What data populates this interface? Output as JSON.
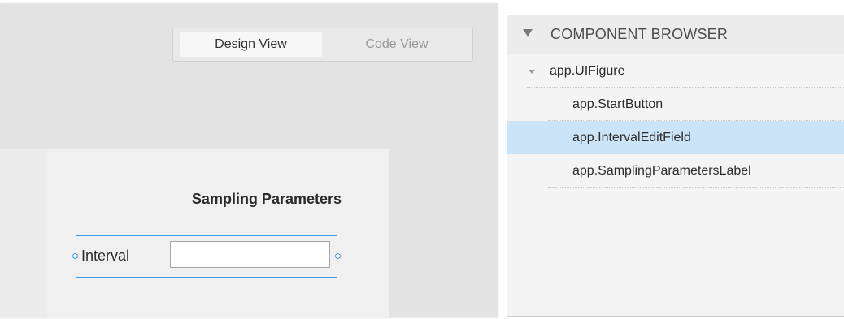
{
  "view_toggle": {
    "design_label": "Design View",
    "code_label": "Code View",
    "active": "Design View"
  },
  "app_figure": {
    "title_label": "Sampling Parameters",
    "interval_label": "Interval",
    "interval_value": ""
  },
  "component_browser": {
    "title": "COMPONENT BROWSER",
    "root": {
      "label": "app.UIFigure",
      "expanded": true
    },
    "children": [
      {
        "label": "app.StartButton",
        "selected": false
      },
      {
        "label": "app.IntervalEditField",
        "selected": true
      },
      {
        "label": "app.SamplingParametersLabel",
        "selected": false
      }
    ]
  },
  "colors": {
    "selection": "#cce4f7",
    "selection_outline": "#3a9ae8",
    "canvas_bg": "#e3e3e3",
    "figure_bg": "#f0f0f0"
  },
  "icons": {
    "browser_collapse": "triangle-down-icon",
    "tree_toggle": "triangle-down-small-icon"
  }
}
